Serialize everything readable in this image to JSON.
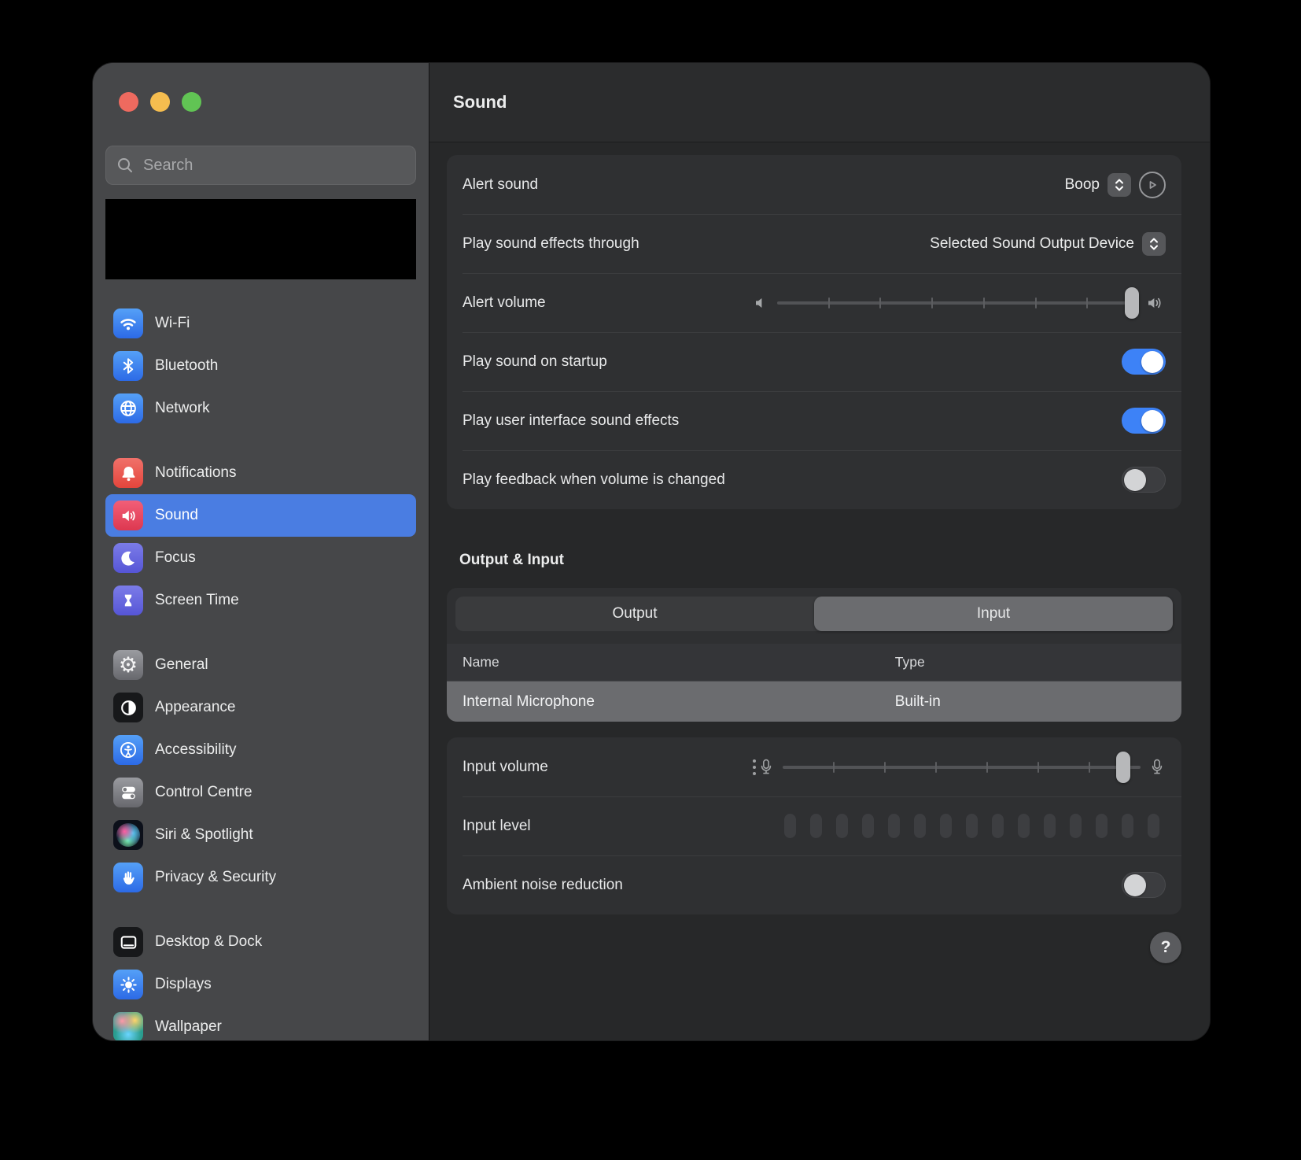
{
  "colors": {
    "traffic_red": "#ee6a5f",
    "traffic_yellow": "#f5bd4f",
    "traffic_green": "#61c454",
    "accent_selection": "#4a7de2",
    "toggle_on": "#3d82f7"
  },
  "sidebar": {
    "search": {
      "placeholder": "Search"
    },
    "groups": [
      {
        "items": [
          {
            "label": "Wi-Fi"
          },
          {
            "label": "Bluetooth"
          },
          {
            "label": "Network"
          }
        ]
      },
      {
        "items": [
          {
            "label": "Notifications"
          },
          {
            "label": "Sound",
            "selected": true
          },
          {
            "label": "Focus"
          },
          {
            "label": "Screen Time"
          }
        ]
      },
      {
        "items": [
          {
            "label": "General"
          },
          {
            "label": "Appearance"
          },
          {
            "label": "Accessibility"
          },
          {
            "label": "Control Centre"
          },
          {
            "label": "Siri & Spotlight"
          },
          {
            "label": "Privacy & Security"
          }
        ]
      },
      {
        "items": [
          {
            "label": "Desktop & Dock"
          },
          {
            "label": "Displays"
          },
          {
            "label": "Wallpaper"
          }
        ]
      }
    ]
  },
  "header": {
    "title": "Sound"
  },
  "effects_card": {
    "alert_sound": {
      "label": "Alert sound",
      "value": "Boop"
    },
    "play_through": {
      "label": "Play sound effects through",
      "value": "Selected Sound Output Device"
    },
    "alert_volume": {
      "label": "Alert volume",
      "value_percent": 100,
      "tick_divisions": 7
    },
    "startup": {
      "label": "Play sound on startup",
      "state": "on"
    },
    "ui_sfx": {
      "label": "Play user interface sound effects",
      "state": "on"
    },
    "feedback": {
      "label": "Play feedback when volume is changed",
      "state": "off"
    }
  },
  "output_input": {
    "heading": "Output & Input",
    "tabs": [
      {
        "label": "Output",
        "selected": false
      },
      {
        "label": "Input",
        "selected": true
      }
    ],
    "table": {
      "columns": [
        "Name",
        "Type"
      ],
      "rows": [
        {
          "name": "Internal Microphone",
          "type": "Built-in",
          "selected": true
        }
      ]
    }
  },
  "input_card": {
    "input_volume": {
      "label": "Input volume",
      "value_percent": 97,
      "tick_divisions": 7
    },
    "input_level": {
      "label": "Input level",
      "segments": 15,
      "active_segments": 0
    },
    "ambient": {
      "label": "Ambient noise reduction",
      "state": "off"
    }
  },
  "help": {
    "label": "?"
  }
}
